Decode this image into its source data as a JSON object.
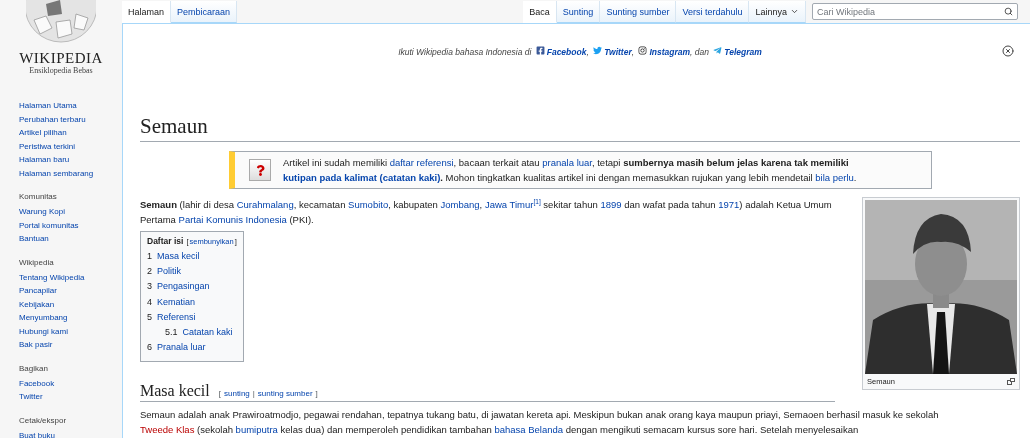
{
  "logo": {
    "wordmark": "WIKIPEDIA",
    "tagline": "Ensiklopedia Bebas"
  },
  "sidebar": [
    {
      "items": [
        "Halaman Utama",
        "Perubahan terbaru",
        "Artikel pilihan",
        "Peristiwa terkini",
        "Halaman baru",
        "Halaman sembarang"
      ]
    },
    {
      "heading": "Komunitas",
      "items": [
        "Warung Kopi",
        "Portal komunitas",
        "Bantuan"
      ]
    },
    {
      "heading": "Wikipedia",
      "items": [
        "Tentang Wikipedia",
        "Pancapilar",
        "Kebijakan",
        "Menyumbang",
        "Hubungi kami",
        "Bak pasir"
      ]
    },
    {
      "heading": "Bagikan",
      "items": [
        "Facebook",
        "Twitter"
      ]
    },
    {
      "heading": "Cetak/ekspor",
      "items": [
        "Buat buku"
      ]
    }
  ],
  "namespace_tabs": [
    {
      "label": "Halaman",
      "selected": true
    },
    {
      "label": "Pembicaraan",
      "selected": false
    }
  ],
  "view_tabs": [
    {
      "label": "Baca",
      "selected": true,
      "kind": "tab"
    },
    {
      "label": "Sunting",
      "selected": false,
      "kind": "tab"
    },
    {
      "label": "Sunting sumber",
      "selected": false,
      "kind": "tab"
    },
    {
      "label": "Versi terdahulu",
      "selected": false,
      "kind": "tab"
    },
    {
      "label": "Lainnya",
      "selected": false,
      "kind": "menu"
    }
  ],
  "search": {
    "placeholder": "Cari Wikipedia"
  },
  "banner": [
    {
      "kind": "text",
      "text": "Ikuti Wikipedia bahasa Indonesia di "
    },
    {
      "kind": "facebook",
      "text": "Facebook"
    },
    {
      "kind": "text",
      "text": ", "
    },
    {
      "kind": "twitter",
      "text": "Twitter"
    },
    {
      "kind": "text",
      "text": ", "
    },
    {
      "kind": "instagram",
      "text": "Instagram"
    },
    {
      "kind": "text",
      "text": ", dan "
    },
    {
      "kind": "telegram",
      "text": "Telegram"
    }
  ],
  "title": "Semaun",
  "notice": [
    {
      "kind": "text",
      "text": "Artikel ini sudah memiliki "
    },
    {
      "kind": "link",
      "text": "daftar referensi"
    },
    {
      "kind": "text",
      "text": ", bacaan terkait atau "
    },
    {
      "kind": "link",
      "text": "pranala luar"
    },
    {
      "kind": "text",
      "text": ", tetapi "
    },
    {
      "kind": "bold",
      "text": "sumbernya masih belum jelas karena tak memiliki "
    },
    {
      "kind": "boldlink",
      "text": "kutipan pada kalimat (catatan kaki)"
    },
    {
      "kind": "bold",
      "text": "."
    },
    {
      "kind": "text",
      "text": " Mohon tingkatkan kualitas artikel ini dengan memasukkan rujukan yang lebih mendetail "
    },
    {
      "kind": "link",
      "text": "bila perlu"
    },
    {
      "kind": "text",
      "text": "."
    }
  ],
  "lead": [
    {
      "kind": "bold",
      "text": "Semaun"
    },
    {
      "kind": "text",
      "text": " (lahir di desa "
    },
    {
      "kind": "link",
      "text": "Curahmalang"
    },
    {
      "kind": "text",
      "text": ", kecamatan "
    },
    {
      "kind": "link",
      "text": "Sumobito"
    },
    {
      "kind": "text",
      "text": ", kabupaten "
    },
    {
      "kind": "link",
      "text": "Jombang"
    },
    {
      "kind": "text",
      "text": ", "
    },
    {
      "kind": "link",
      "text": "Jawa Timur"
    },
    {
      "kind": "sup",
      "text": "[1]"
    },
    {
      "kind": "text",
      "text": " sekitar tahun "
    },
    {
      "kind": "link",
      "text": "1899"
    },
    {
      "kind": "text",
      "text": " dan wafat pada tahun "
    },
    {
      "kind": "link",
      "text": "1971"
    },
    {
      "kind": "text",
      "text": ") adalah Ketua Umum Pertama "
    },
    {
      "kind": "link",
      "text": "Partai Komunis Indonesia"
    },
    {
      "kind": "text",
      "text": " (PKI)."
    }
  ],
  "infobox": {
    "caption": "Semaun"
  },
  "toc": {
    "title": "Daftar isi",
    "toggle": {
      "open": "[",
      "label": "sembunyikan",
      "close": "]"
    },
    "items": [
      {
        "number": "1",
        "label": "Masa kecil"
      },
      {
        "number": "2",
        "label": "Politik"
      },
      {
        "number": "3",
        "label": "Pengasingan"
      },
      {
        "number": "4",
        "label": "Kematian"
      },
      {
        "number": "5",
        "label": "Referensi",
        "children": [
          {
            "number": "5.1",
            "label": "Catatan kaki"
          }
        ]
      },
      {
        "number": "6",
        "label": "Pranala luar"
      }
    ]
  },
  "section": {
    "heading": "Masa kecil",
    "edit": {
      "open": "[",
      "links": [
        "sunting",
        "sunting sumber"
      ],
      "separator": "|",
      "close": "]"
    },
    "paragraph": [
      {
        "kind": "text",
        "text": "Semaun adalah anak Prawiroatmodjo, pegawai rendahan, tepatnya tukang batu, di jawatan kereta api. Meskipun bukan anak orang kaya maupun priayi, Semaoen berhasil masuk ke sekolah "
      },
      {
        "kind": "redlink",
        "text": "Tweede Klas"
      },
      {
        "kind": "text",
        "text": " (sekolah "
      },
      {
        "kind": "link",
        "text": "bumiputra"
      },
      {
        "kind": "text",
        "text": " kelas dua) dan memperoleh pendidikan tambahan "
      },
      {
        "kind": "link",
        "text": "bahasa Belanda"
      },
      {
        "kind": "text",
        "text": " dengan mengikuti semacam kursus sore hari. Setelah menyelesaikan"
      }
    ]
  }
}
